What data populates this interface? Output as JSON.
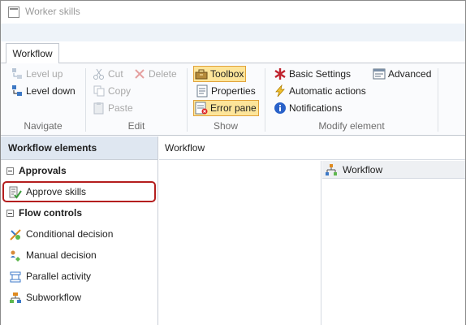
{
  "window": {
    "title": "Worker skills"
  },
  "ribbon": {
    "tab": "Workflow",
    "navigate": {
      "label": "Navigate",
      "level_up": "Level up",
      "level_down": "Level down"
    },
    "edit": {
      "label": "Edit",
      "cut": "Cut",
      "copy": "Copy",
      "paste": "Paste",
      "delete": "Delete"
    },
    "show": {
      "label": "Show",
      "toolbox": "Toolbox",
      "properties": "Properties",
      "error_pane": "Error pane"
    },
    "modify": {
      "label": "Modify element",
      "basic_settings": "Basic Settings",
      "automatic_actions": "Automatic actions",
      "notifications": "Notifications",
      "advanced": "Advanced"
    }
  },
  "left_pane": {
    "header": "Workflow elements",
    "groups": [
      {
        "title": "Approvals",
        "items": [
          "Approve skills"
        ]
      },
      {
        "title": "Flow controls",
        "items": [
          "Conditional decision",
          "Manual decision",
          "Parallel activity",
          "Subworkflow"
        ]
      }
    ]
  },
  "right_pane": {
    "header": "Workflow",
    "node_label": "Workflow"
  },
  "colors": {
    "selected_fill": "#fde59a",
    "selected_border": "#e1a23a",
    "highlight_border": "#b41e1e",
    "pane_header": "#dfe7f1"
  }
}
